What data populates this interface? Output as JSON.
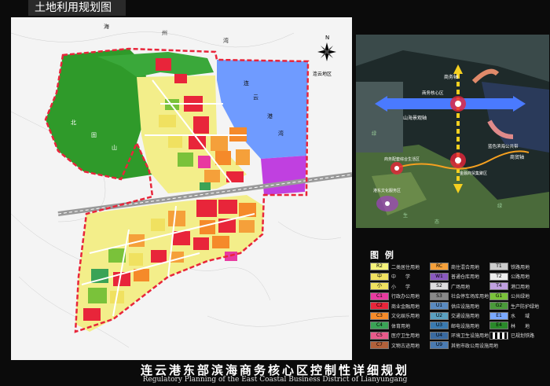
{
  "title": "土地利用规划图",
  "footer": {
    "cn": "连云港东部滨海商务核心区控制性详细规划",
    "en": "Regulatory Planning of the East Coastal Business District of Lianyungang"
  },
  "map": {
    "compass_n": "N",
    "location_label": "连云地区",
    "labels": {
      "sea1": "海",
      "sea2": "州",
      "sea3": "湾",
      "bay_top": "连",
      "bay_mid": "云",
      "bay_low": "港",
      "bay_bottom": "湾",
      "hill1": "北",
      "hill2": "固",
      "hill3": "山"
    }
  },
  "side_map": {
    "labels": {
      "business_axis": "商务轴",
      "core": "商务核心区",
      "shanhai_axis": "山海景观轴",
      "trade_axis": "商贸轴",
      "blue_band": "蓝色滨海公共带",
      "mixed_center": "商务配套综合生活区",
      "finance_center": "金融商贸集聚区",
      "culture_center": "港东文化服务区",
      "green_green": "绿",
      "green_state": "态",
      "eco_2": "生",
      "eco_3": "绿"
    }
  },
  "legend": {
    "title": "图 例",
    "items": [
      {
        "code": "R2",
        "label": "二类居住用地",
        "color": "#f5f27a"
      },
      {
        "code": "中",
        "label": "中　　学",
        "color": "#f0e160"
      },
      {
        "code": "小",
        "label": "小　　学",
        "color": "#f0e160"
      },
      {
        "code": "C1",
        "label": "行政办公用地",
        "color": "#e83aa0"
      },
      {
        "code": "C2",
        "label": "商业金融用地",
        "color": "#e8253a"
      },
      {
        "code": "C3",
        "label": "文化娱乐用地",
        "color": "#f58a2a"
      },
      {
        "code": "C4",
        "label": "体育用地",
        "color": "#3aa356"
      },
      {
        "code": "C5",
        "label": "医疗卫生用地",
        "color": "#e85a8a"
      },
      {
        "code": "C7",
        "label": "文物古迹用地",
        "color": "#b0603a"
      },
      {
        "code": "RC",
        "label": "商住混合用地",
        "color": "#f5a03a"
      },
      {
        "code": "W1",
        "label": "普通仓库用地",
        "color": "#8a5ac0"
      },
      {
        "code": "S2",
        "label": "广场用地",
        "color": "#dddddd"
      },
      {
        "code": "S3",
        "label": "社会停车场库用地",
        "color": "#888888"
      },
      {
        "code": "U1",
        "label": "供应设施用地",
        "color": "#5a8ac0"
      },
      {
        "code": "U2",
        "label": "交通设施用地",
        "color": "#5aa0c0"
      },
      {
        "code": "U3",
        "label": "邮电设施用地",
        "color": "#3a7ab0"
      },
      {
        "code": "U4",
        "label": "环境卫生设施用地",
        "color": "#3a6aa0"
      },
      {
        "code": "U9",
        "label": "其他市政公用设施用地",
        "color": "#4a7ab0"
      },
      {
        "code": "T1",
        "label": "铁路用地",
        "color": "#cccccc"
      },
      {
        "code": "T2",
        "label": "公路用地",
        "color": "#eeeeee"
      },
      {
        "code": "T4",
        "label": "港口用地",
        "color": "#c0a0e0"
      },
      {
        "code": "G1",
        "label": "公共绿地",
        "color": "#7ac23a"
      },
      {
        "code": "G2",
        "label": "生产防护绿地",
        "color": "#4a9a3a"
      },
      {
        "code": "E1",
        "label": "水　　域",
        "color": "#7aa8ff"
      },
      {
        "code": "E4",
        "label": "林　　地",
        "color": "#2a8a2a"
      },
      {
        "code": "",
        "label": "已规划铁路",
        "color": "#000000"
      }
    ]
  }
}
